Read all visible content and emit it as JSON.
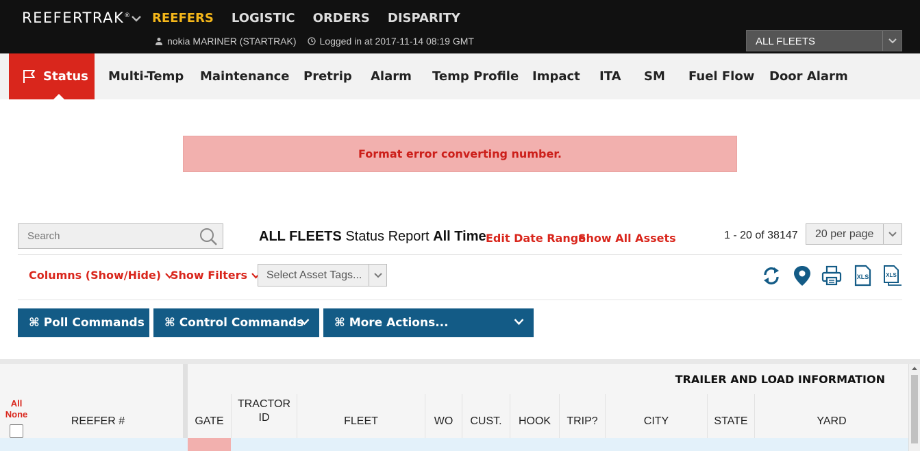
{
  "app": {
    "logo": "REEFERTRAK",
    "logo_mark": "®",
    "nav": [
      "REEFERS",
      "LOGISTIC",
      "ORDERS",
      "DISPARITY"
    ],
    "active_nav": "REEFERS",
    "user": "nokia MARINER (STARTRAK)",
    "login_info": "Logged in at 2017-11-14 08:19 GMT",
    "fleet_select": "ALL FLEETS"
  },
  "tabs": [
    "Status",
    "Multi-Temp",
    "Maintenance",
    "Pretrip",
    "Alarm",
    "Temp Profile",
    "Impact",
    "ITA",
    "SM",
    "Fuel Flow",
    "Door Alarm"
  ],
  "active_tab": "Status",
  "alert": {
    "message": "Format error converting number."
  },
  "report": {
    "search_placeholder": "Search",
    "fleet": "ALL FLEETS",
    "report_name": "Status Report",
    "range": "All Time",
    "edit_date_range": "Edit Date Range",
    "show_all_assets": "Show All Assets",
    "page_range": "1 - 20 of 38147",
    "per_page": "20 per page"
  },
  "filters": {
    "columns": "Columns (Show/Hide)",
    "show_filters": "Show Filters",
    "asset_tags_placeholder": "Select Asset Tags..."
  },
  "tools": [
    "refresh-icon",
    "map-pin-icon",
    "print-icon",
    "xls-icon",
    "xls-multi-icon"
  ],
  "actions": {
    "poll": "⌘ Poll Commands",
    "control": "⌘ Control Commands",
    "more": "⌘ More Actions..."
  },
  "table": {
    "group_header": "TRAILER AND LOAD INFORMATION",
    "select_all": "All",
    "select_none": "None",
    "left_column": "REEFER #",
    "columns": [
      {
        "key": "gate",
        "label": "GATE"
      },
      {
        "key": "tractor_line1",
        "label": "TRACTOR"
      },
      {
        "key": "tractor_line2",
        "label": "ID"
      },
      {
        "key": "fleet",
        "label": "FLEET"
      },
      {
        "key": "wo",
        "label": "WO"
      },
      {
        "key": "cust",
        "label": "CUST."
      },
      {
        "key": "hook",
        "label": "HOOK"
      },
      {
        "key": "trip",
        "label": "TRIP?"
      },
      {
        "key": "city",
        "label": "CITY"
      },
      {
        "key": "state",
        "label": "STATE"
      },
      {
        "key": "yard",
        "label": "YARD"
      }
    ]
  },
  "colors": {
    "accent_red": "#d9261c",
    "nav_active": "#f5b71a",
    "button_blue": "#135b86",
    "alert_bg": "#f2b0ae",
    "icon_blue": "#135b86"
  }
}
